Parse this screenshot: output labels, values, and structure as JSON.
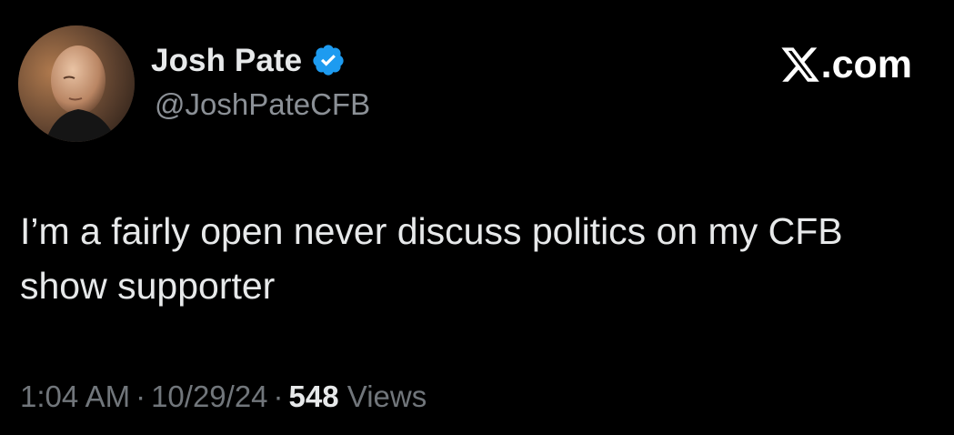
{
  "author": {
    "display_name": "Josh Pate",
    "handle": "@JoshPateCFB",
    "verified": true,
    "verified_color": "#1d9bf0",
    "avatar_icon": "profile-photo"
  },
  "brand": {
    "icon": "x-logo-icon",
    "text": ".com"
  },
  "tweet": {
    "text": "I’m a fairly open never discuss politics on my CFB show supporter"
  },
  "meta": {
    "time": "1:04 AM",
    "date": "10/29/24",
    "separator": "·",
    "views_count": "548",
    "views_label": "Views"
  },
  "colors": {
    "background": "#000000",
    "primary_text": "#e7e9ea",
    "secondary_text": "#71767b"
  }
}
